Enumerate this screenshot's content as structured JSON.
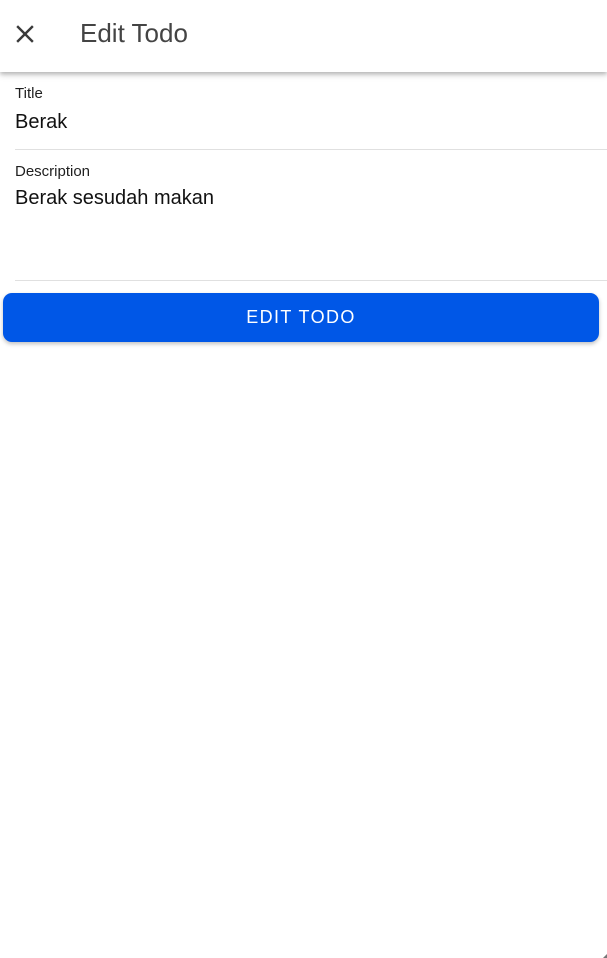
{
  "app_bar": {
    "title": "Edit Todo",
    "close_icon": "close-icon"
  },
  "form": {
    "title_field": {
      "label": "Title",
      "value": "Berak"
    },
    "description_field": {
      "label": "Description",
      "value": "Berak sesudah makan"
    },
    "submit_label": "EDIT TODO"
  },
  "colors": {
    "primary": "#0057e7",
    "app_bar_bg": "#ffffff",
    "title_text": "#444444",
    "divider": "#e0e0e0"
  }
}
